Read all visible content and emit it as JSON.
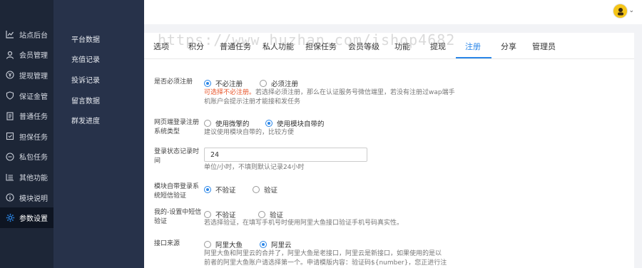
{
  "sidebar": {
    "items": [
      {
        "label": "站点后台",
        "icon": "chart-icon"
      },
      {
        "label": "会员管理",
        "icon": "user-icon"
      },
      {
        "label": "提现管理",
        "icon": "yen-icon"
      },
      {
        "label": "保证金管",
        "icon": "shield-icon"
      },
      {
        "label": "普通任务",
        "icon": "document-icon"
      },
      {
        "label": "担保任务",
        "icon": "guarantee-icon"
      },
      {
        "label": "私包任务",
        "icon": "private-icon"
      },
      {
        "label": "其他功能",
        "icon": "list-icon"
      },
      {
        "label": "模块说明",
        "icon": "info-icon"
      },
      {
        "label": "参数设置",
        "icon": "gear-icon"
      }
    ],
    "active_index": 9
  },
  "subnav": {
    "items": [
      "平台数据",
      "充值记录",
      "投诉记录",
      "留言数据",
      "群发进度"
    ]
  },
  "tabs": [
    "选项",
    "积分",
    "普通任务",
    "私人功能",
    "担保任务",
    "会员等级",
    "功能",
    "提现",
    "注册",
    "分享",
    "管理员"
  ],
  "active_tab": "注册",
  "watermark": "https://www.huzhan.com/ishop4682",
  "form": {
    "must_register": {
      "label": "是否必须注册",
      "opt1": "不必注册",
      "opt2": "必须注册",
      "help_warn": "可选择不必注册。",
      "help": "若选择必须注册，那么在认证服务号微信端里，若没有注册过wap端手机账户会提示注册才能接和发任务"
    },
    "page_style": {
      "label": "网页端登录注册系统类型",
      "opt1": "使用微擎的",
      "opt2": "使用模块自带的",
      "help": "建议使用模块自带的，比较方便"
    },
    "login_time": {
      "label": "登录状态记录时间",
      "value": "24",
      "help": "单位/小时，不填则默认记录24小时"
    },
    "module_sms": {
      "label": "模块自带登录系统短信验证",
      "opt1": "不验证",
      "opt2": "验证"
    },
    "my_sms": {
      "label": "我的-设置中短信验证",
      "opt1": "不验证",
      "opt2": "验证",
      "help": "若选择验证，在填写手机号时使用阿里大鱼接口验证手机号码真实性。"
    },
    "api_source": {
      "label": "接口来源",
      "opt1": "阿里大鱼",
      "opt2": "阿里云",
      "help1": "阿里大鱼和阿里云的合并了，阿里大鱼是老接口，阿里云是新接口，如果使用的是以",
      "help2": "前者的阿里大鱼账户请选择第一个。申请模版内容：验证码${number}，您正进行注"
    }
  },
  "colors": {
    "accent": "#2a86e8",
    "sidebar": "#1d2637",
    "subnav": "#27324a",
    "warn": "#e8552a"
  }
}
